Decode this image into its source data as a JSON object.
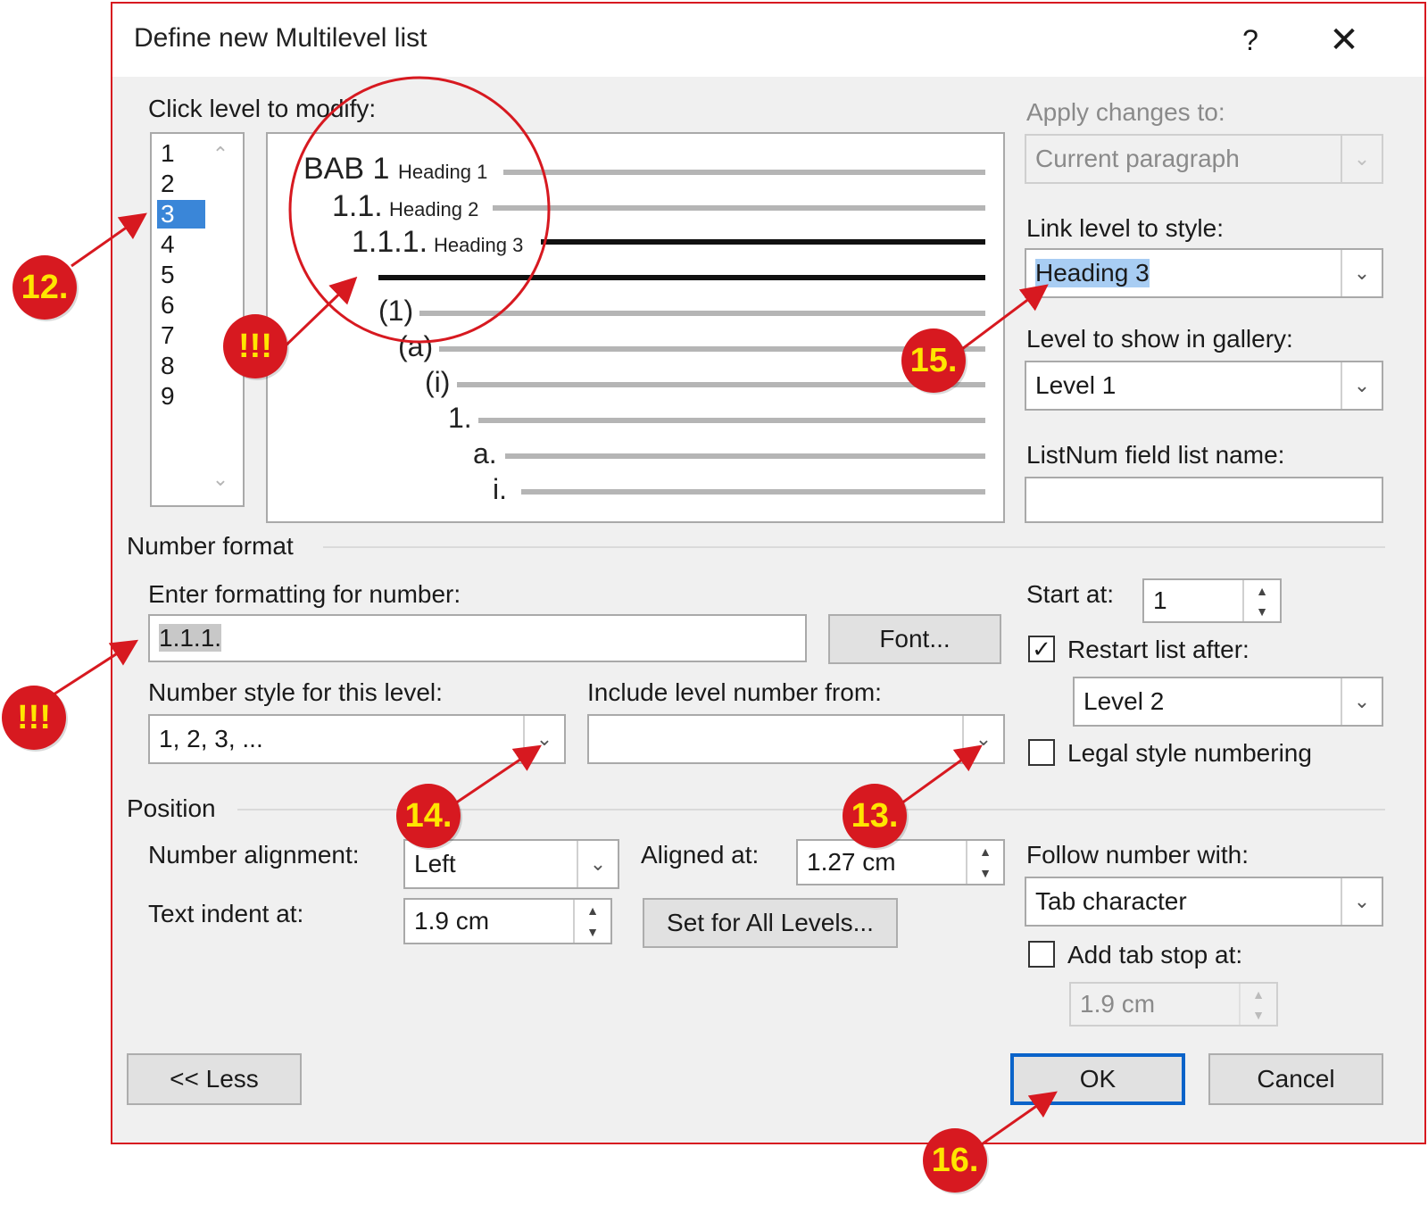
{
  "dialog": {
    "title": "Define new Multilevel list",
    "help": "?",
    "close": "✕"
  },
  "levels": {
    "label": "Click level to modify:",
    "items": [
      "1",
      "2",
      "3",
      "4",
      "5",
      "6",
      "7",
      "8",
      "9"
    ],
    "selected": "3"
  },
  "preview": {
    "bab": "BAB 1",
    "h1": "Heading 1",
    "l2": "1.1.",
    "h2": "Heading 2",
    "l3": "1.1.1.",
    "h3": "Heading 3",
    "l5": "(1)",
    "l6": "(a)",
    "l7": "(i)",
    "l8": "1.",
    "l9": "a.",
    "l10": "i."
  },
  "right_panel": {
    "apply_label": "Apply changes to:",
    "apply_value": "Current paragraph",
    "link_label": "Link level to style:",
    "link_value": "Heading 3",
    "gallery_label": "Level to show in gallery:",
    "gallery_value": "Level 1",
    "listnum_label": "ListNum field list name:",
    "listnum_value": ""
  },
  "number_format": {
    "group": "Number format",
    "enter_label": "Enter formatting for number:",
    "format_value": "1.1.1.",
    "font_button": "Font...",
    "style_label": "Number style for this level:",
    "style_value": "1, 2, 3, ...",
    "include_label": "Include level number from:",
    "include_value": "",
    "start_label": "Start at:",
    "start_value": "1",
    "restart_label": "Restart list after:",
    "restart_checked": "✓",
    "restart_value": "Level 2",
    "legal_label": "Legal style numbering"
  },
  "position": {
    "group": "Position",
    "alignment_label": "Number alignment:",
    "alignment_value": "Left",
    "aligned_label": "Aligned at:",
    "aligned_value": "1.27 cm",
    "indent_label": "Text indent at:",
    "indent_value": "1.9 cm",
    "set_all_button": "Set for All Levels...",
    "follow_label": "Follow number with:",
    "follow_value": "Tab character",
    "tabstop_label": "Add tab stop at:",
    "tabstop_value": "1.9 cm"
  },
  "footer": {
    "less": "<< Less",
    "ok": "OK",
    "cancel": "Cancel"
  },
  "annotations": {
    "m12": "12.",
    "m13": "13.",
    "m14": "14.",
    "m15": "15.",
    "m16": "16.",
    "warn1": "!!!",
    "warn2": "!!!"
  },
  "colors": {
    "accent": "#d71920",
    "marker_text": "#ffe600",
    "selection": "#3a86d8",
    "default_button": "#0a63c9"
  }
}
